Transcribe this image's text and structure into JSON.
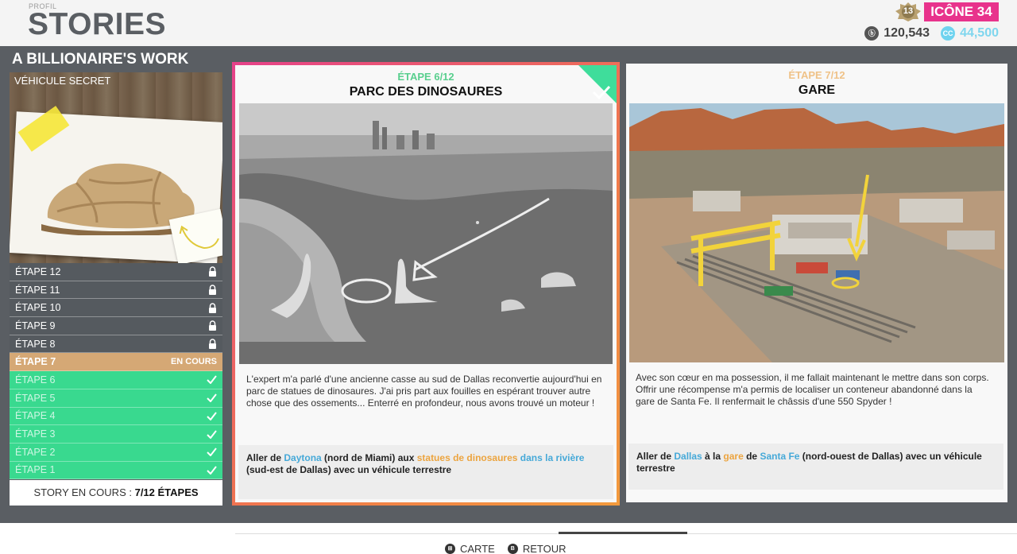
{
  "header": {
    "breadcrumb": "PROFIL",
    "title": "STORIES",
    "level": "13",
    "rank": "ICÔNE 34",
    "credits": "120,543",
    "crew_credits": "44,500",
    "credits_icon": "ⓑ",
    "cc_icon": "CC"
  },
  "story": {
    "title": "A BILLIONAIRE'S WORK",
    "secret_label": "VÉHICULE SECRET",
    "steps": [
      {
        "label": "ÉTAPE 12",
        "state": "locked"
      },
      {
        "label": "ÉTAPE 11",
        "state": "locked"
      },
      {
        "label": "ÉTAPE 10",
        "state": "locked"
      },
      {
        "label": "ÉTAPE 9",
        "state": "locked"
      },
      {
        "label": "ÉTAPE 8",
        "state": "locked"
      },
      {
        "label": "ÉTAPE 7",
        "state": "current",
        "status": "EN COURS"
      },
      {
        "label": "ÉTAPE 6",
        "state": "done"
      },
      {
        "label": "ÉTAPE 5",
        "state": "done"
      },
      {
        "label": "ÉTAPE 4",
        "state": "done"
      },
      {
        "label": "ÉTAPE 3",
        "state": "done"
      },
      {
        "label": "ÉTAPE 2",
        "state": "done"
      },
      {
        "label": "ÉTAPE 1",
        "state": "done"
      }
    ],
    "status_prefix": "STORY EN COURS : ",
    "status_value": "7/12 ÉTAPES"
  },
  "cards": [
    {
      "step": "ÉTAPE 6/12",
      "name": "PARC DES DINOSAURES",
      "completed": true,
      "description": "L'expert m'a parlé d'une ancienne casse au sud de Dallas reconvertie aujourd'hui en parc de statues de dinosaures. J'ai pris part aux fouilles en espérant trouver autre chose que des ossements... Enterré en profondeur, nous avons trouvé un moteur !",
      "objective": [
        {
          "t": "Aller de ",
          "c": ""
        },
        {
          "t": "Daytona",
          "c": "blue"
        },
        {
          "t": " (nord de Miami) aux ",
          "c": ""
        },
        {
          "t": "statues de dinosaures",
          "c": "orange"
        },
        {
          "t": " dans la rivière",
          "c": "blue"
        },
        {
          "t": " (sud-est de Dallas) avec un véhicule terrestre",
          "c": ""
        }
      ]
    },
    {
      "step": "ÉTAPE 7/12",
      "name": "GARE",
      "completed": false,
      "description": "Avec son cœur en ma possession, il me fallait maintenant le mettre dans son corps. Offrir une récompense m'a permis de localiser un conteneur abandonné dans la gare de Santa Fe. Il renfermait le châssis d'une 550 Spyder !",
      "objective": [
        {
          "t": "Aller de ",
          "c": ""
        },
        {
          "t": "Dallas",
          "c": "blue"
        },
        {
          "t": " à la ",
          "c": ""
        },
        {
          "t": "gare",
          "c": "orange"
        },
        {
          "t": " de ",
          "c": ""
        },
        {
          "t": "Santa Fe",
          "c": "blue"
        },
        {
          "t": " (nord-ouest de Dallas) avec un véhicule terrestre",
          "c": ""
        }
      ]
    }
  ],
  "footer": {
    "map_glyph": "⊞",
    "map_label": "CARTE",
    "back_glyph": "B",
    "back_label": "RETOUR"
  },
  "colors": {
    "accent_pink": "#e8338c",
    "done_green": "#39d98f",
    "current_tan": "#d5a875",
    "highlight_blue": "#46a9d8",
    "highlight_orange": "#eca43f"
  },
  "icons": [
    "lock-icon",
    "check-icon",
    "level-badge-icon",
    "credits-icon",
    "crew-credits-icon"
  ]
}
